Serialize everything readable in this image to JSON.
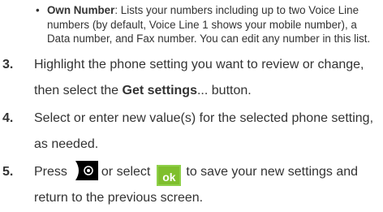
{
  "bullet": {
    "term": "Own Number",
    "line1_rest": ": Lists your numbers including up to two Voice Line",
    "line2": "numbers (by default, Voice Line 1 shows your mobile number), a",
    "line3": "Data number, and Fax number. You can edit any number in this list."
  },
  "steps": [
    {
      "num": "3.",
      "l1": "Highlight the phone setting you want to review or change,",
      "l2_pre": "then select the ",
      "l2_bold": "Get settings",
      "l2_post": "... button."
    },
    {
      "num": "4.",
      "l1": "Select or enter new value(s) for the selected phone setting,",
      "l2": "as needed."
    },
    {
      "num": "5.",
      "l1_pre": "Press",
      "l1_mid": "or select",
      "ok_label": "ok",
      "l1_post": "to save your new settings and",
      "l2": "return to the previous screen."
    }
  ],
  "icons": {
    "end_key": "end-key-icon",
    "ok_button": "ok-button-icon"
  },
  "colors": {
    "ok_green": "#7fbf2e",
    "end_key_black": "#000000"
  }
}
